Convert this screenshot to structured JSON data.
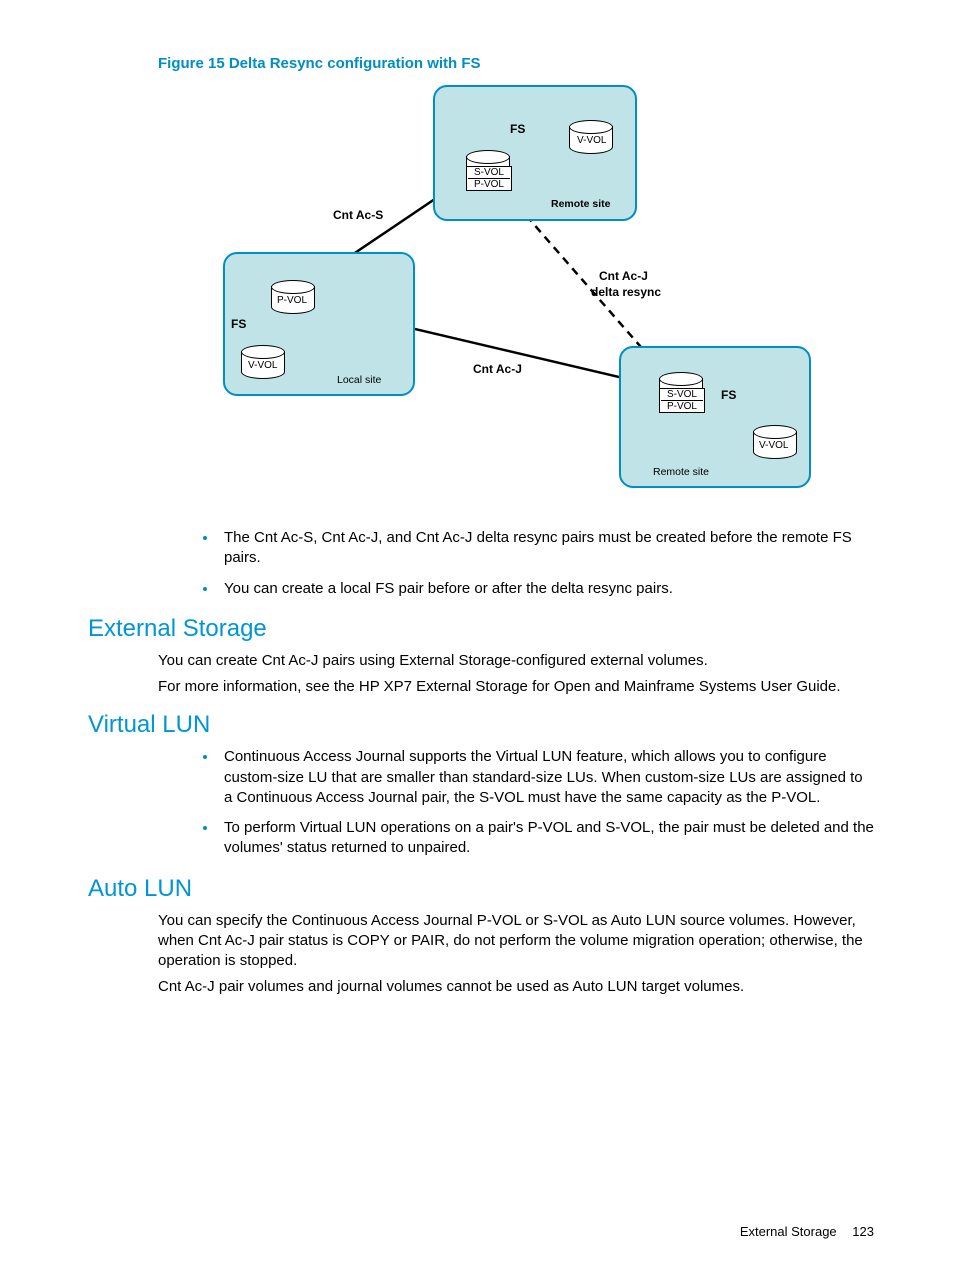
{
  "figure": {
    "caption": "Figure 15 Delta Resync configuration with FS",
    "labels": {
      "fs": "FS",
      "vvol": "V-VOL",
      "pvol": "P-VOL",
      "svol": "S-VOL",
      "local_site": "Local site",
      "remote_site_upper": "Remote site",
      "remote_site_lower": "Remote site",
      "cnt_ac_s": "Cnt Ac-S",
      "cnt_ac_j": "Cnt Ac-J",
      "cnt_ac_j_delta_1": "Cnt Ac-J",
      "cnt_ac_j_delta_2": "delta resync"
    }
  },
  "bullets_top": [
    "The Cnt Ac-S, Cnt Ac-J, and Cnt Ac-J delta resync pairs must be created before the remote FS pairs.",
    "You can create a local FS pair before or after the delta resync pairs."
  ],
  "sections": {
    "external_storage": {
      "heading": "External Storage",
      "p1": "You can create Cnt Ac-J pairs using External Storage-configured external volumes.",
      "p2": "For more information, see the HP XP7 External Storage for Open and Mainframe Systems User Guide."
    },
    "virtual_lun": {
      "heading": "Virtual LUN",
      "bullets": [
        "Continuous Access Journal supports the Virtual LUN feature, which allows you to configure custom-size LU that are smaller than standard-size LUs. When custom-size LUs are assigned to a Continuous Access Journal pair, the S-VOL must have the same capacity as the P-VOL.",
        "To perform Virtual LUN operations on a pair's P-VOL and S-VOL, the pair must be deleted and the volumes' status returned to unpaired."
      ]
    },
    "auto_lun": {
      "heading": "Auto LUN",
      "p1": "You can specify the Continuous Access Journal P-VOL or S-VOL as Auto LUN source volumes. However, when Cnt Ac-J pair status is COPY or PAIR, do not perform the volume migration operation; otherwise, the operation is stopped.",
      "p2": "Cnt Ac-J pair volumes and journal volumes cannot be used as Auto LUN target volumes."
    }
  },
  "footer": {
    "section": "External Storage",
    "page": "123"
  }
}
